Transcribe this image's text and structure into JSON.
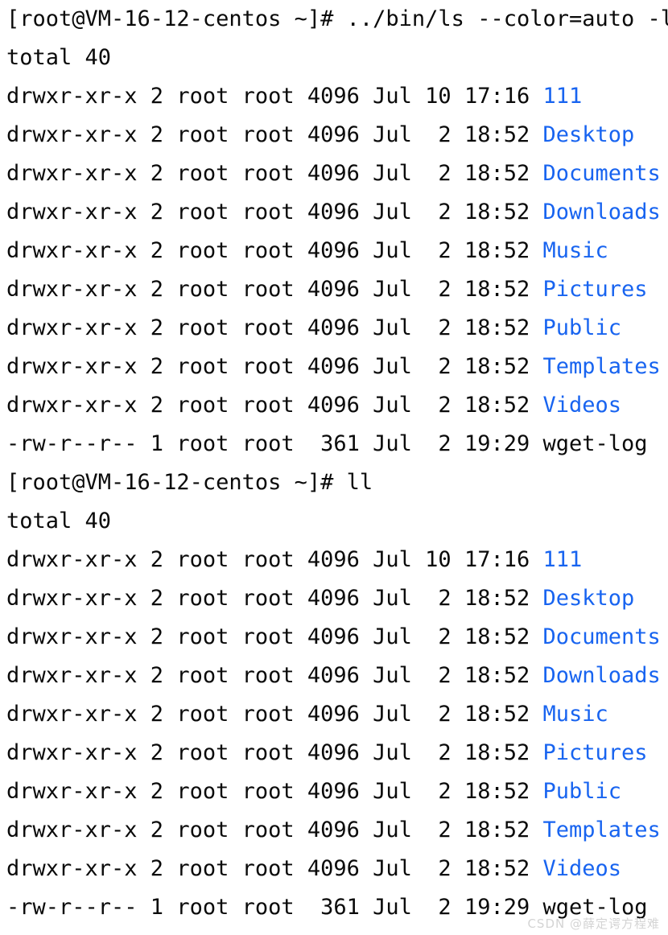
{
  "terminal": {
    "background_color": "#ffffff",
    "text_color": "#0a0a0a",
    "directory_color": "#1864f0",
    "prompt": "[root@VM-16-12-centos ~]#",
    "lines": [
      {
        "name": "prompt-line-1",
        "segments": [
          {
            "text": "[root@VM-16-12-centos ~]# ../bin/ls --color=auto -l",
            "type": "default"
          }
        ]
      },
      {
        "name": "total-line-1",
        "segments": [
          {
            "text": "total 40",
            "type": "default"
          }
        ]
      },
      {
        "name": "listing-row-111-1",
        "segments": [
          {
            "text": "drwxr-xr-x 2 root root 4096 Jul 10 17:16 ",
            "type": "default"
          },
          {
            "text": "111",
            "type": "dir"
          }
        ]
      },
      {
        "name": "listing-row-desktop-1",
        "segments": [
          {
            "text": "drwxr-xr-x 2 root root 4096 Jul  2 18:52 ",
            "type": "default"
          },
          {
            "text": "Desktop",
            "type": "dir"
          }
        ]
      },
      {
        "name": "listing-row-documents-1",
        "segments": [
          {
            "text": "drwxr-xr-x 2 root root 4096 Jul  2 18:52 ",
            "type": "default"
          },
          {
            "text": "Documents",
            "type": "dir"
          }
        ]
      },
      {
        "name": "listing-row-downloads-1",
        "segments": [
          {
            "text": "drwxr-xr-x 2 root root 4096 Jul  2 18:52 ",
            "type": "default"
          },
          {
            "text": "Downloads",
            "type": "dir"
          }
        ]
      },
      {
        "name": "listing-row-music-1",
        "segments": [
          {
            "text": "drwxr-xr-x 2 root root 4096 Jul  2 18:52 ",
            "type": "default"
          },
          {
            "text": "Music",
            "type": "dir"
          }
        ]
      },
      {
        "name": "listing-row-pictures-1",
        "segments": [
          {
            "text": "drwxr-xr-x 2 root root 4096 Jul  2 18:52 ",
            "type": "default"
          },
          {
            "text": "Pictures",
            "type": "dir"
          }
        ]
      },
      {
        "name": "listing-row-public-1",
        "segments": [
          {
            "text": "drwxr-xr-x 2 root root 4096 Jul  2 18:52 ",
            "type": "default"
          },
          {
            "text": "Public",
            "type": "dir"
          }
        ]
      },
      {
        "name": "listing-row-templates-1",
        "segments": [
          {
            "text": "drwxr-xr-x 2 root root 4096 Jul  2 18:52 ",
            "type": "default"
          },
          {
            "text": "Templates",
            "type": "dir"
          }
        ]
      },
      {
        "name": "listing-row-videos-1",
        "segments": [
          {
            "text": "drwxr-xr-x 2 root root 4096 Jul  2 18:52 ",
            "type": "default"
          },
          {
            "text": "Videos",
            "type": "dir"
          }
        ]
      },
      {
        "name": "listing-row-wgetlog-1",
        "segments": [
          {
            "text": "-rw-r--r-- 1 root root  361 Jul  2 19:29 wget-log",
            "type": "default"
          }
        ]
      },
      {
        "name": "prompt-line-2",
        "segments": [
          {
            "text": "[root@VM-16-12-centos ~]# ll",
            "type": "default"
          }
        ]
      },
      {
        "name": "total-line-2",
        "segments": [
          {
            "text": "total 40",
            "type": "default"
          }
        ]
      },
      {
        "name": "listing-row-111-2",
        "segments": [
          {
            "text": "drwxr-xr-x 2 root root 4096 Jul 10 17:16 ",
            "type": "default"
          },
          {
            "text": "111",
            "type": "dir"
          }
        ]
      },
      {
        "name": "listing-row-desktop-2",
        "segments": [
          {
            "text": "drwxr-xr-x 2 root root 4096 Jul  2 18:52 ",
            "type": "default"
          },
          {
            "text": "Desktop",
            "type": "dir"
          }
        ]
      },
      {
        "name": "listing-row-documents-2",
        "segments": [
          {
            "text": "drwxr-xr-x 2 root root 4096 Jul  2 18:52 ",
            "type": "default"
          },
          {
            "text": "Documents",
            "type": "dir"
          }
        ]
      },
      {
        "name": "listing-row-downloads-2",
        "segments": [
          {
            "text": "drwxr-xr-x 2 root root 4096 Jul  2 18:52 ",
            "type": "default"
          },
          {
            "text": "Downloads",
            "type": "dir"
          }
        ]
      },
      {
        "name": "listing-row-music-2",
        "segments": [
          {
            "text": "drwxr-xr-x 2 root root 4096 Jul  2 18:52 ",
            "type": "default"
          },
          {
            "text": "Music",
            "type": "dir"
          }
        ]
      },
      {
        "name": "listing-row-pictures-2",
        "segments": [
          {
            "text": "drwxr-xr-x 2 root root 4096 Jul  2 18:52 ",
            "type": "default"
          },
          {
            "text": "Pictures",
            "type": "dir"
          }
        ]
      },
      {
        "name": "listing-row-public-2",
        "segments": [
          {
            "text": "drwxr-xr-x 2 root root 4096 Jul  2 18:52 ",
            "type": "default"
          },
          {
            "text": "Public",
            "type": "dir"
          }
        ]
      },
      {
        "name": "listing-row-templates-2",
        "segments": [
          {
            "text": "drwxr-xr-x 2 root root 4096 Jul  2 18:52 ",
            "type": "default"
          },
          {
            "text": "Templates",
            "type": "dir"
          }
        ]
      },
      {
        "name": "listing-row-videos-2",
        "segments": [
          {
            "text": "drwxr-xr-x 2 root root 4096 Jul  2 18:52 ",
            "type": "default"
          },
          {
            "text": "Videos",
            "type": "dir"
          }
        ]
      },
      {
        "name": "listing-row-wgetlog-2",
        "segments": [
          {
            "text": "-rw-r--r-- 1 root root  361 Jul  2 19:29 wget-log",
            "type": "default"
          }
        ]
      }
    ]
  },
  "watermark": {
    "text": "CSDN @薛定谔方程难"
  }
}
